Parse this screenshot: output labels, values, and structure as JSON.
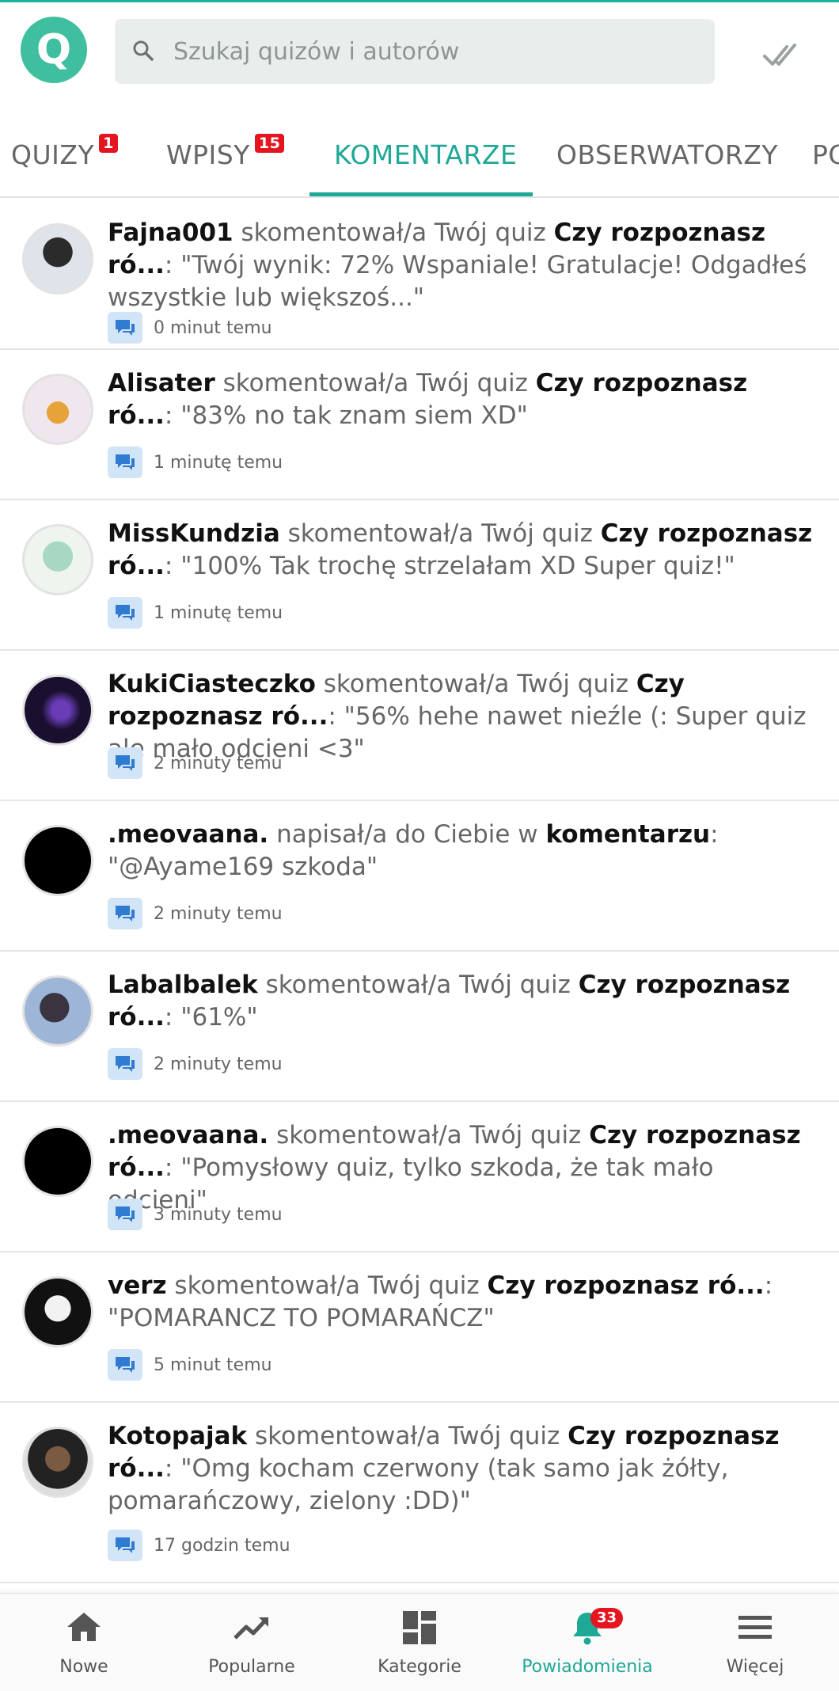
{
  "header": {
    "logo_letter": "Q",
    "search_placeholder": "Szukaj quizów i autorów"
  },
  "tabs": [
    {
      "label": "QUIZY",
      "badge": "1"
    },
    {
      "label": "WPISY",
      "badge": "15"
    },
    {
      "label": "KOMENTARZE",
      "badge": ""
    },
    {
      "label": "OBSERWATORZY",
      "badge": ""
    },
    {
      "label": "PO",
      "badge": ""
    }
  ],
  "notifications": [
    {
      "user": "Fajna001",
      "action": " skomentował/a Twój quiz ",
      "target": "Czy rozpoznasz ró...",
      "comment": ": \"Twój wynik: 72% Wspaniale! Gratulacje! Odgadłeś wszystkie lub większoś...\"",
      "time": "0 minut temu"
    },
    {
      "user": "Alisater",
      "action": " skomentował/a Twój quiz ",
      "target": "Czy rozpoznasz ró...",
      "comment": ": \"83% no tak znam siem XD\"",
      "time": "1 minutę temu"
    },
    {
      "user": "MissKundzia",
      "action": " skomentował/a Twój quiz ",
      "target": "Czy rozpoznasz ró...",
      "comment": ": \"100% Tak trochę strzelałam XD Super quiz!\"",
      "time": "1 minutę temu"
    },
    {
      "user": "KukiCiasteczko",
      "action": " skomentował/a Twój quiz ",
      "target": "Czy rozpoznasz ró...",
      "comment": ": \"56% hehe nawet nieźle (: Super quiz ale mało odcieni <3\"",
      "time": "2 minuty temu"
    },
    {
      "user": ".meovaana.",
      "action": " napisał/a do Ciebie w ",
      "target": "komentarzu",
      "comment": ": \"@Ayame169 szkoda\"",
      "time": "2 minuty temu"
    },
    {
      "user": "Labalbalek",
      "action": " skomentował/a Twój quiz ",
      "target": "Czy rozpoznasz ró...",
      "comment": ": \"61%\"",
      "time": "2 minuty temu"
    },
    {
      "user": ".meovaana.",
      "action": " skomentował/a Twój quiz ",
      "target": "Czy rozpoznasz ró...",
      "comment": ": \"Pomysłowy quiz, tylko szkoda, że tak mało odcieni\"",
      "time": "3 minuty temu"
    },
    {
      "user": "verz",
      "action": " skomentował/a Twój quiz ",
      "target": "Czy rozpoznasz ró...",
      "comment": ": \"POMARANCZ TO POMARAŃCZ\"",
      "time": "5 minut temu"
    },
    {
      "user": "Kotopajak",
      "action": " skomentował/a Twój quiz ",
      "target": "Czy rozpoznasz ró...",
      "comment": ": \"Omg kocham czerwony (tak samo jak żółty, pomarańczowy, zielony :DD)\"",
      "time": "17 godzin temu"
    }
  ],
  "bottom_nav": [
    {
      "label": "Nowe",
      "icon": "home-icon"
    },
    {
      "label": "Popularne",
      "icon": "trending-icon"
    },
    {
      "label": "Kategorie",
      "icon": "categories-icon"
    },
    {
      "label": "Powiadomienia",
      "icon": "bell-icon",
      "badge": "33"
    },
    {
      "label": "Więcej",
      "icon": "menu-icon"
    }
  ],
  "colors": {
    "accent": "#1fa896",
    "badge": "#e4151f",
    "logo": "#3fbf9f"
  }
}
